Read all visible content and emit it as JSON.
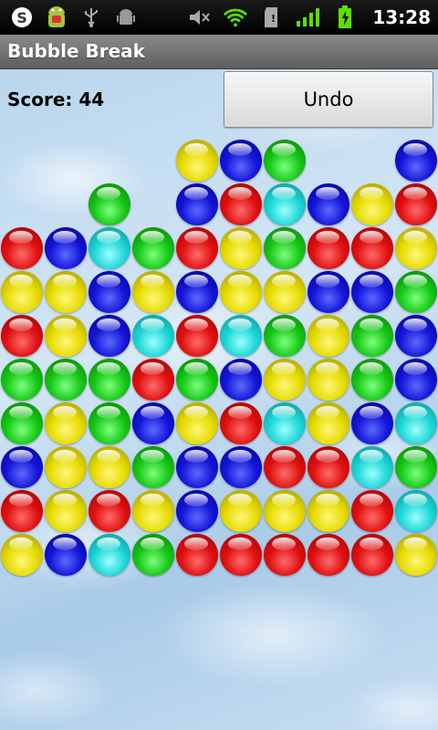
{
  "status_bar": {
    "time": "13:28",
    "icons": [
      "skype-icon",
      "android-app-icon",
      "usb-icon",
      "debug-android-icon",
      "mute-icon",
      "wifi-icon",
      "sd-card-icon",
      "signal-icon",
      "battery-charging-icon"
    ]
  },
  "app": {
    "title": "Bubble Break"
  },
  "game": {
    "score_label": "Score: 44",
    "undo_label": "Undo",
    "colors": {
      "red": "#e01010",
      "blue": "#1515d8",
      "green": "#16c816",
      "yellow": "#e6dc00",
      "cyan": "#1ed6d6"
    },
    "columns": 10,
    "rows": 10,
    "grid": [
      [
        "",
        "",
        "",
        "",
        "Y",
        "B",
        "G",
        "",
        "",
        "B"
      ],
      [
        "",
        "",
        "G",
        "",
        "B",
        "R",
        "C",
        "B",
        "Y",
        "R"
      ],
      [
        "R",
        "B",
        "C",
        "G",
        "R",
        "Y",
        "G",
        "R",
        "R",
        "Y"
      ],
      [
        "Y",
        "Y",
        "B",
        "Y",
        "B",
        "Y",
        "Y",
        "B",
        "B",
        "G"
      ],
      [
        "R",
        "Y",
        "B",
        "C",
        "R",
        "C",
        "G",
        "Y",
        "G",
        "B"
      ],
      [
        "G",
        "G",
        "G",
        "R",
        "G",
        "B",
        "Y",
        "Y",
        "G",
        "B"
      ],
      [
        "G",
        "Y",
        "G",
        "B",
        "Y",
        "R",
        "C",
        "Y",
        "B",
        "C"
      ],
      [
        "B",
        "Y",
        "Y",
        "G",
        "B",
        "B",
        "R",
        "R",
        "C",
        "G"
      ],
      [
        "R",
        "Y",
        "R",
        "Y",
        "B",
        "Y",
        "Y",
        "Y",
        "R",
        "C"
      ],
      [
        "Y",
        "B",
        "C",
        "G",
        "R",
        "R",
        "R",
        "R",
        "R",
        "Y"
      ]
    ]
  }
}
